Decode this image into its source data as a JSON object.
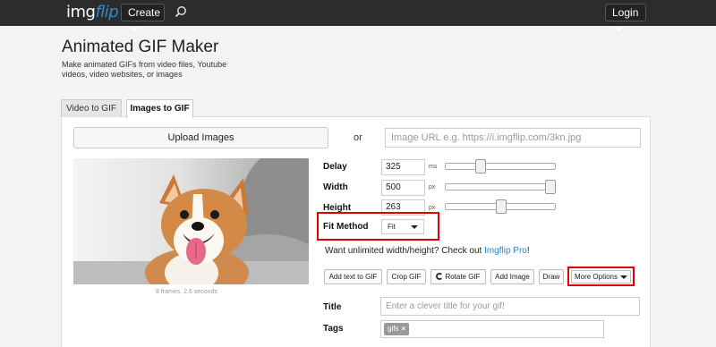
{
  "topbar": {
    "logo_img": "img",
    "logo_flip": "flip",
    "create_label": "Create",
    "login_label": "Login"
  },
  "header": {
    "title": "Animated GIF Maker",
    "subtitle": "Make animated GIFs from video files, Youtube videos, video websites, or images"
  },
  "tabs": [
    {
      "label": "Video to GIF",
      "active": false
    },
    {
      "label": "Images to GIF",
      "active": true
    }
  ],
  "upload": {
    "button_label": "Upload Images",
    "or_text": "or",
    "url_placeholder": "Image URL e.g. https://i.imgflip.com/3kn.jpg"
  },
  "preview": {
    "caption": "8 frames, 2.6 seconds"
  },
  "settings": {
    "delay": {
      "label": "Delay",
      "value": "325",
      "unit": "ms",
      "slider_fraction": 0.3
    },
    "width": {
      "label": "Width",
      "value": "500",
      "unit": "px",
      "slider_fraction": 1.0
    },
    "height": {
      "label": "Height",
      "value": "263",
      "unit": "px",
      "slider_fraction": 0.51
    },
    "fit_method": {
      "label": "Fit Method",
      "value": "Fit"
    }
  },
  "promo": {
    "text": "Want unlimited width/height? Check out ",
    "link": "Imgflip Pro",
    "suffix": "!"
  },
  "tools": {
    "add_text": "Add text to GIF",
    "crop": "Crop GIF",
    "rotate": "Rotate GIF",
    "add_image": "Add Image",
    "draw": "Draw",
    "more": "More Options"
  },
  "meta": {
    "title_label": "Title",
    "title_placeholder": "Enter a clever title for your gif!",
    "tags_label": "Tags",
    "tags": [
      "gifs"
    ]
  },
  "colors": {
    "topbar": "#2c2c2c",
    "link": "#1e88d8",
    "highlight": "#e00000"
  }
}
